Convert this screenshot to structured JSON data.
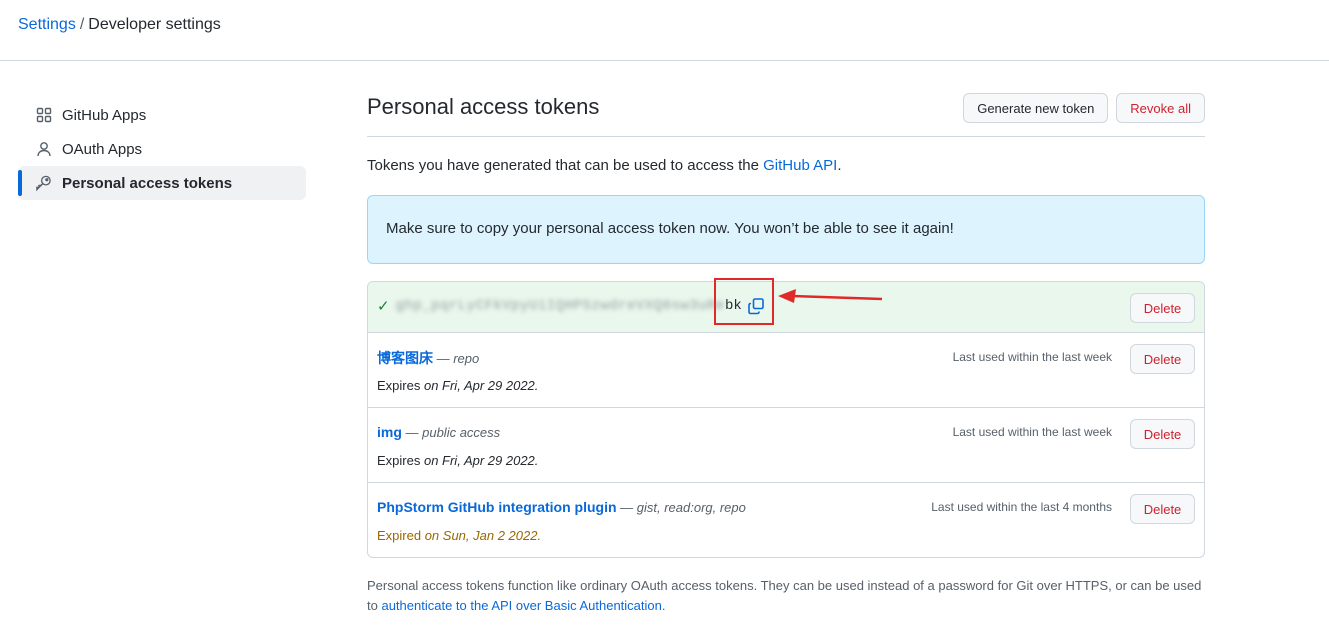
{
  "breadcrumb": {
    "root": "Settings",
    "separator": "/",
    "current": "Developer settings"
  },
  "sidebar": {
    "items": [
      {
        "label": "GitHub Apps",
        "icon": "apps-grid-icon"
      },
      {
        "label": "OAuth Apps",
        "icon": "person-icon"
      },
      {
        "label": "Personal access tokens",
        "icon": "key-icon",
        "active": true
      }
    ]
  },
  "header": {
    "title": "Personal access tokens",
    "generate_label": "Generate new token",
    "revoke_label": "Revoke all"
  },
  "intro": {
    "text": "Tokens you have generated that can be used to access the ",
    "link": "GitHub API",
    "suffix": "."
  },
  "flash": {
    "message": "Make sure to copy your personal access token now. You won’t be able to see it again!"
  },
  "new_token": {
    "masked": "ghp_pqrLyCFkVpyUiIQHPSzwdreVXQ0sw3uRe",
    "tail": "bk",
    "delete_label": "Delete"
  },
  "tokens": [
    {
      "name": "博客图床",
      "scope": " — repo",
      "last_used": "Last used within the last week",
      "expires_prefix": "Expires ",
      "expires_date": "on Fri, Apr 29 2022.",
      "expired": false,
      "delete_label": "Delete"
    },
    {
      "name": "img",
      "scope": " — public access",
      "last_used": "Last used within the last week",
      "expires_prefix": "Expires ",
      "expires_date": "on Fri, Apr 29 2022.",
      "expired": false,
      "delete_label": "Delete"
    },
    {
      "name": "PhpStorm GitHub integration plugin",
      "scope": " — gist, read:org, repo",
      "last_used": "Last used within the last 4 months",
      "expires_prefix": "Expired ",
      "expires_date": "on Sun, Jan 2 2022.",
      "expired": true,
      "delete_label": "Delete"
    }
  ],
  "footer": {
    "text": "Personal access tokens function like ordinary OAuth access tokens. They can be used instead of a password for Git over HTTPS, or can be used to ",
    "link": "authenticate to the API over Basic Authentication",
    "suffix": "."
  },
  "colors": {
    "link": "#0969da",
    "danger": "#cf222e",
    "success": "#1a7f37",
    "annotation": "#e02a2a",
    "flash_bg": "#ddf4ff"
  }
}
